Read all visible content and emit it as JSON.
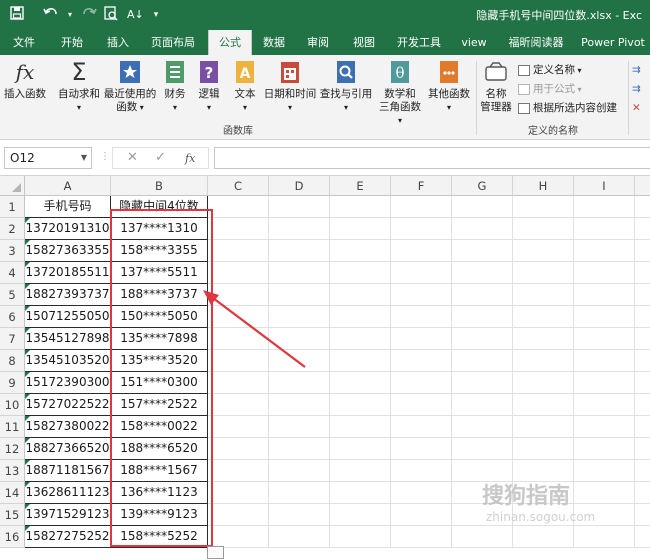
{
  "window": {
    "doc_title": "隐藏手机号中间四位数.xlsx - Exc",
    "quick_access": [
      "save-icon",
      "undo-icon",
      "redo-icon",
      "print-preview-icon",
      "sort-icon",
      "customize-icon"
    ]
  },
  "tabs": [
    {
      "label": "文件"
    },
    {
      "label": "开始"
    },
    {
      "label": "插入"
    },
    {
      "label": "页面布局"
    },
    {
      "label": "公式",
      "active": true
    },
    {
      "label": "数据"
    },
    {
      "label": "审阅"
    },
    {
      "label": "视图"
    },
    {
      "label": "开发工具"
    },
    {
      "label": "view"
    },
    {
      "label": "福昕阅读器"
    },
    {
      "label": "Power Pivot"
    }
  ],
  "ribbon": {
    "insert_function": "插入函数",
    "autosum": "自动求和",
    "recent_line1": "最近使用的",
    "recent_line2": "函数",
    "financial": "财务",
    "logical": "逻辑",
    "text": "文本",
    "datetime": "日期和时间",
    "lookup": "查找与引用",
    "math_line1": "数学和",
    "math_line2": "三角函数",
    "other": "其他函数",
    "group_library": "函数库",
    "name_manager_line1": "名称",
    "name_manager_line2": "管理器",
    "define_name": "定义名称",
    "use_in_formula": "用于公式",
    "create_from_selection": "根据所选内容创建",
    "group_names": "定义的名称"
  },
  "formula_bar": {
    "name_box": "O12",
    "fx_label": "fx",
    "content": ""
  },
  "sheet": {
    "columns": [
      "A",
      "B",
      "C",
      "D",
      "E",
      "F",
      "G",
      "H",
      "I"
    ],
    "header_row": {
      "a": "手机号码",
      "b": "隐藏中间4位数"
    },
    "rows": [
      {
        "num": "1"
      },
      {
        "num": "2",
        "a": "13720191310",
        "b": "137****1310"
      },
      {
        "num": "3",
        "a": "15827363355",
        "b": "158****3355"
      },
      {
        "num": "4",
        "a": "13720185511",
        "b": "137****5511"
      },
      {
        "num": "5",
        "a": "18827393737",
        "b": "188****3737"
      },
      {
        "num": "6",
        "a": "15071255050",
        "b": "150****5050"
      },
      {
        "num": "7",
        "a": "13545127898",
        "b": "135****7898"
      },
      {
        "num": "8",
        "a": "13545103520",
        "b": "135****3520"
      },
      {
        "num": "9",
        "a": "15172390300",
        "b": "151****0300"
      },
      {
        "num": "10",
        "a": "15727022522",
        "b": "157****2522"
      },
      {
        "num": "11",
        "a": "15827380022",
        "b": "158****0022"
      },
      {
        "num": "12",
        "a": "18827366520",
        "b": "188****6520"
      },
      {
        "num": "13",
        "a": "18871181567",
        "b": "188****1567"
      },
      {
        "num": "14",
        "a": "13628611123",
        "b": "136****1123"
      },
      {
        "num": "15",
        "a": "13971529123",
        "b": "139****9123"
      },
      {
        "num": "16",
        "a": "15827275252",
        "b": "158****5252"
      }
    ]
  },
  "annotation": {
    "highlight_color": "#e0363f"
  },
  "watermark": {
    "main": "搜狗指南",
    "sub": "zhinan.sogou.com"
  },
  "colors": {
    "excel_green": "#217346",
    "ribbon_bg": "#f3f3f3"
  }
}
